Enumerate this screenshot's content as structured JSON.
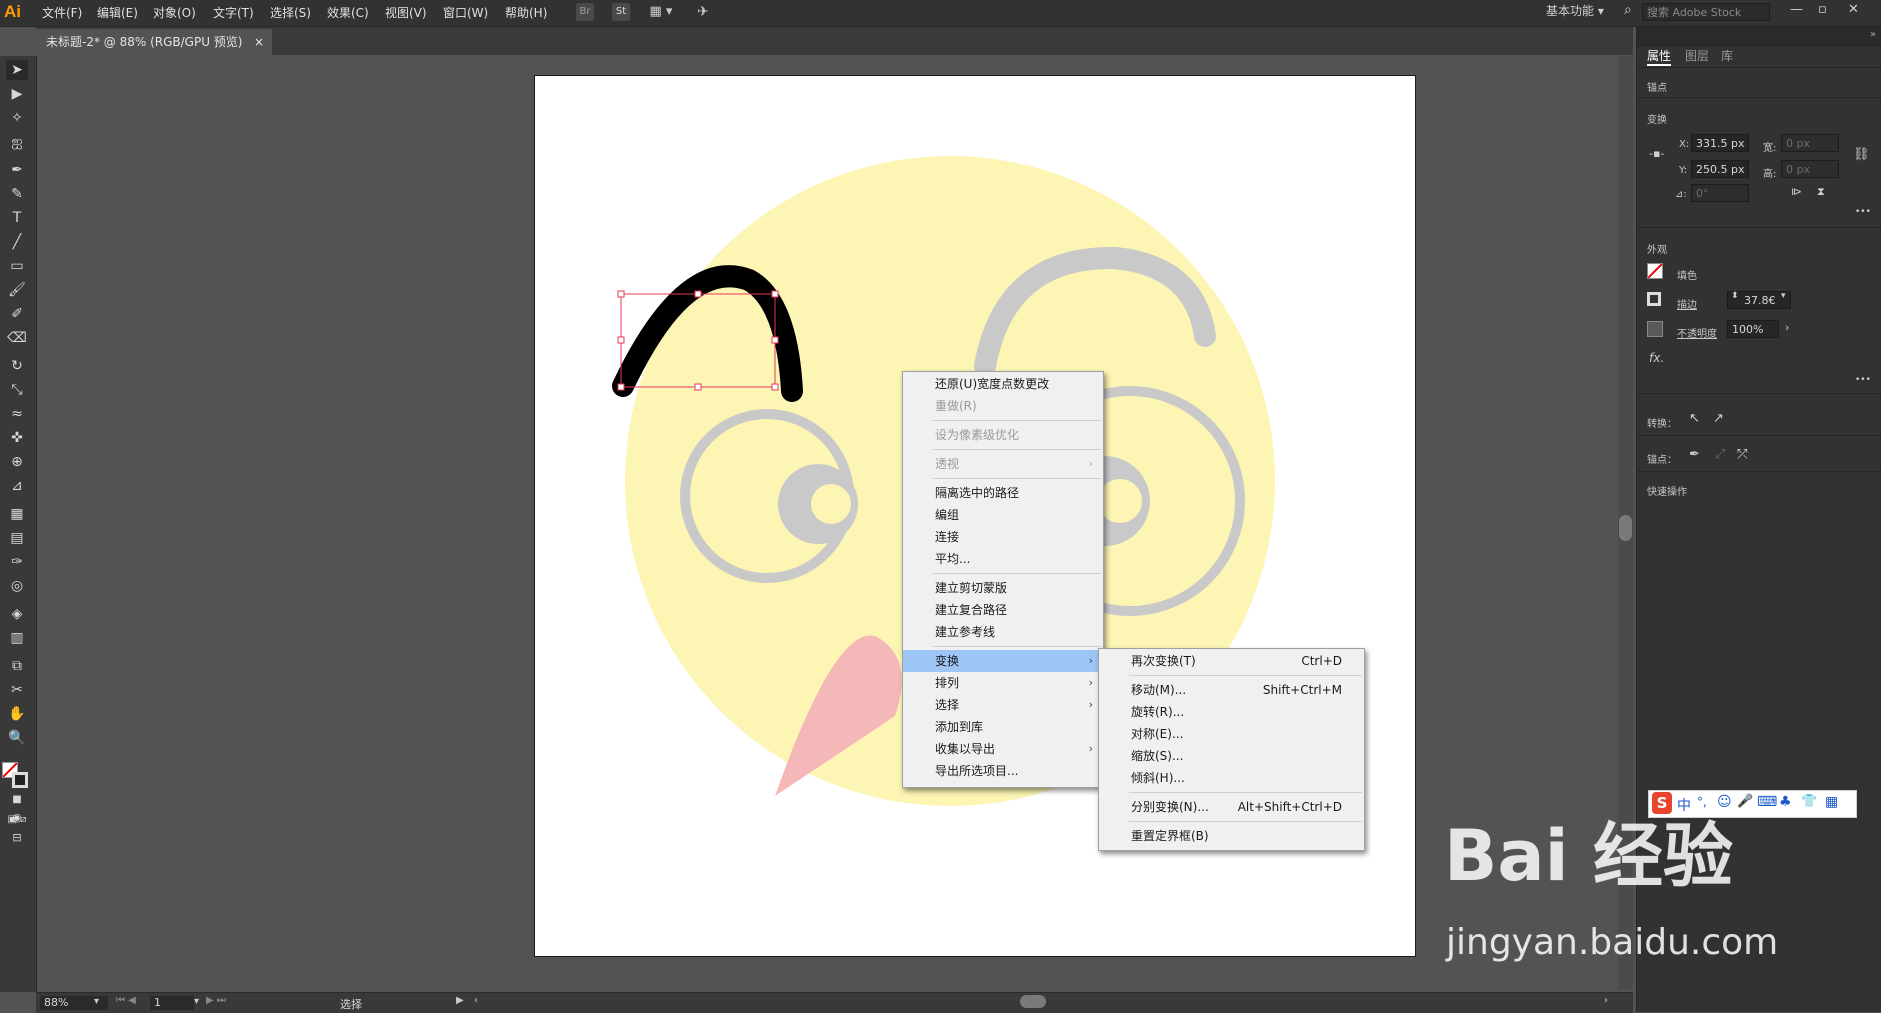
{
  "app": {
    "logo": "Ai",
    "workspace": "基本功能",
    "stock_placeholder": "搜索 Adobe Stock"
  },
  "menubar": [
    "文件(F)",
    "编辑(E)",
    "对象(O)",
    "文字(T)",
    "选择(S)",
    "效果(C)",
    "视图(V)",
    "窗口(W)",
    "帮助(H)"
  ],
  "toolbar_icons": {
    "br": "Br",
    "st": "St"
  },
  "document_tab": {
    "title": "未标题-2* @ 88% (RGB/GPU 预览)",
    "close": "×"
  },
  "panel": {
    "tabs": [
      "属性",
      "图层",
      "库"
    ],
    "anchor_section": "锚点",
    "transform_section": "变换",
    "x_label": "X:",
    "x_value": "331.5 px",
    "y_label": "Y:",
    "y_value": "250.5 px",
    "w_label": "宽:",
    "w_value": "0 px",
    "h_label": "高:",
    "h_value": "0 px",
    "angle_label": "⊿:",
    "angle_value": "0°",
    "appearance_section": "外观",
    "fill_label": "填色",
    "stroke_label": "描边",
    "stroke_value": "37.8€",
    "opacity_label": "不透明度",
    "opacity_value": "100%",
    "fx_label": "fx.",
    "convert_label": "转换：",
    "anchor_label": "锚点：",
    "quick_actions": "快速操作",
    "more": "•••"
  },
  "context_menu": {
    "items": [
      {
        "label": "还原(U)宽度点数更改",
        "disabled": false
      },
      {
        "label": "重做(R)",
        "disabled": true
      },
      {
        "label": "设为像素级优化",
        "disabled": true
      },
      {
        "label": "透视",
        "disabled": true
      },
      {
        "label": "隔离选中的路径",
        "disabled": false
      },
      {
        "label": "编组",
        "disabled": false
      },
      {
        "label": "连接",
        "disabled": false
      },
      {
        "label": "平均...",
        "disabled": false
      },
      {
        "label": "建立剪切蒙版",
        "disabled": false
      },
      {
        "label": "建立复合路径",
        "disabled": false
      },
      {
        "label": "建立参考线",
        "disabled": false
      },
      {
        "label": "变换",
        "disabled": false
      },
      {
        "label": "排列",
        "disabled": false
      },
      {
        "label": "选择",
        "disabled": false
      },
      {
        "label": "添加到库",
        "disabled": false
      },
      {
        "label": "收集以导出",
        "disabled": false
      },
      {
        "label": "导出所选项目...",
        "disabled": false
      }
    ],
    "submenu_arrow": "›"
  },
  "transform_submenu": {
    "items": [
      {
        "label": "再次变换(T)",
        "shortcut": "Ctrl+D"
      },
      {
        "label": "移动(M)...",
        "shortcut": "Shift+Ctrl+M"
      },
      {
        "label": "旋转(R)...",
        "shortcut": ""
      },
      {
        "label": "对称(E)...",
        "shortcut": ""
      },
      {
        "label": "缩放(S)...",
        "shortcut": ""
      },
      {
        "label": "倾斜(H)...",
        "shortcut": ""
      },
      {
        "label": "分别变换(N)...",
        "shortcut": "Alt+Shift+Ctrl+D"
      },
      {
        "label": "重置定界框(B)",
        "shortcut": ""
      }
    ]
  },
  "status": {
    "zoom": "88%",
    "page": "1",
    "tool": "选择"
  },
  "ime": {
    "items": [
      "S",
      "中",
      "°,",
      "☺",
      "🎤",
      "⌨",
      "♣",
      "👕",
      "▦"
    ]
  },
  "watermark": {
    "line1": "Bai 经验",
    "line2": "jingyan.baidu.com"
  },
  "colors": {
    "face": "#fcf5b4",
    "eye": "#c9c9c9",
    "tongue": "#f5b8b8",
    "selection": "#e8385a",
    "menu_highlight": "#9dc5f5"
  }
}
